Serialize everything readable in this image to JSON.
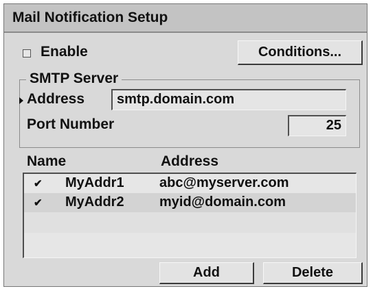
{
  "dialog": {
    "title": "Mail Notification Setup"
  },
  "enable": {
    "label": "Enable",
    "checked": false
  },
  "conditions_button": {
    "label": "Conditions..."
  },
  "smtp": {
    "group_label": "SMTP Server",
    "address_label": "Address",
    "address_value": "smtp.domain.com",
    "port_label": "Port Number",
    "port_value": "25"
  },
  "recipients": {
    "columns": [
      "Name",
      "Address"
    ],
    "rows": [
      {
        "check": "✔",
        "name": "MyAddr1",
        "address": "abc@myserver.com"
      },
      {
        "check": "✔",
        "name": "MyAddr2",
        "address": "myid@domain.com"
      }
    ]
  },
  "buttons": {
    "add": "Add",
    "delete": "Delete"
  }
}
